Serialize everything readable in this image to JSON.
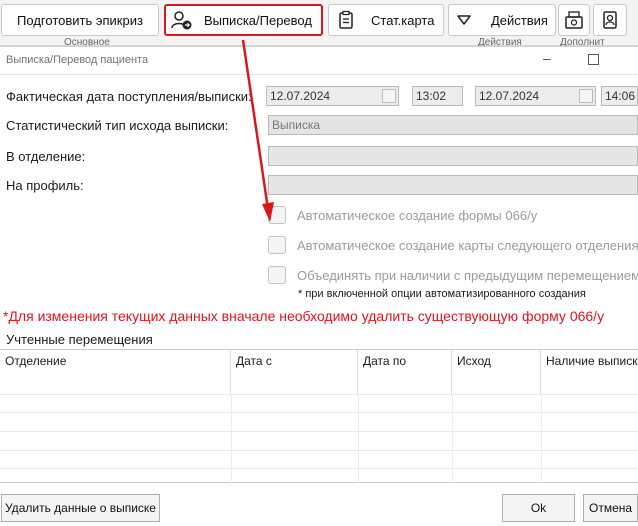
{
  "ribbon": {
    "prepare_epicrisis": "Подготовить эпикриз",
    "discharge_transfer": "Выписка/Перевод",
    "stat_card": "Стат.карта",
    "actions": "Действия",
    "group_main": "Основное",
    "group_actions": "Действия",
    "group_extra": "Дополнит"
  },
  "dialog": {
    "title": "Выписка/Перевод пациента",
    "actual_date_label": "Фактическая дата поступления/выписки:",
    "admission_date": "12.07.2024",
    "admission_time": "13:02",
    "discharge_date": "12.07.2024",
    "discharge_time": "14:06",
    "outcome_type_label": "Статистический тип исхода выписки:",
    "outcome_type_value": "Выписка",
    "department_label": "В отделение:",
    "department_value": "",
    "profile_label": "На профиль:",
    "profile_value": "",
    "auto_form_label": "Автоматическое создание формы 066/у",
    "auto_card_label": "Автоматическое создание карты следующего отделения",
    "merge_label": "Объединять при наличии с предыдущим перемещением",
    "auto_note": "* при включенной опции автоматизированного создания",
    "warning": "*Для изменения текущих данных вначале необходимо удалить существующую форму 066/у",
    "movements_title": "Учтенные перемещения"
  },
  "table": {
    "headers": [
      "Отделение",
      "Дата с",
      "Дата по",
      "Исход",
      "Наличие выписки"
    ]
  },
  "buttons": {
    "delete_discharge": "Удалить данные о выписке",
    "ok": "Ok",
    "cancel": "Отмена"
  },
  "colors": {
    "highlight": "#d7191c",
    "warning": "#e0141e"
  }
}
